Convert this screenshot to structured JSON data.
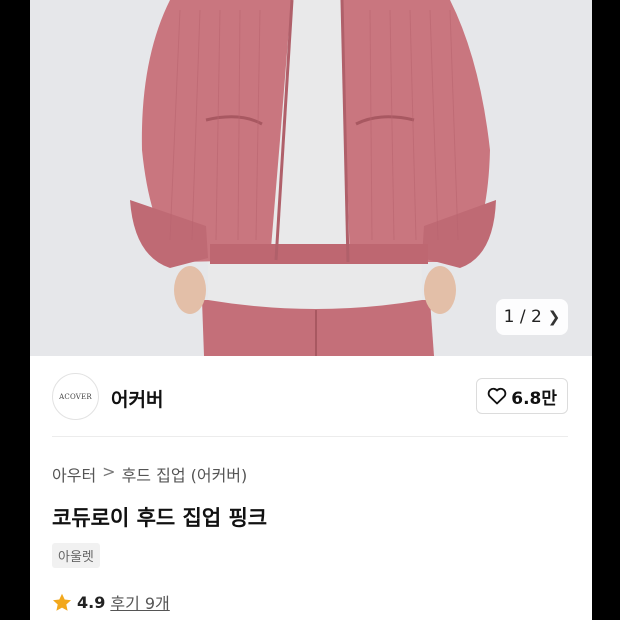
{
  "gallery": {
    "counter": "1 / 2",
    "next_icon": "chevron-right-icon"
  },
  "brand": {
    "logo_text": "ACOVER",
    "name": "어커버",
    "likes": "6.8만",
    "like_icon": "heart-outline-icon"
  },
  "product": {
    "breadcrumb": [
      "아우터",
      "후드 집업 (어커버)"
    ],
    "breadcrumb_separator": ">",
    "title": "코듀로이 후드 집업 핑크",
    "tag": "아울렛",
    "rating": "4.9",
    "reviews": "후기 9개",
    "star_color": "#F2A81D"
  },
  "colors": {
    "jacket": "#C9767F",
    "tee": "#E9E9EA",
    "background": "#E6E7EA"
  }
}
